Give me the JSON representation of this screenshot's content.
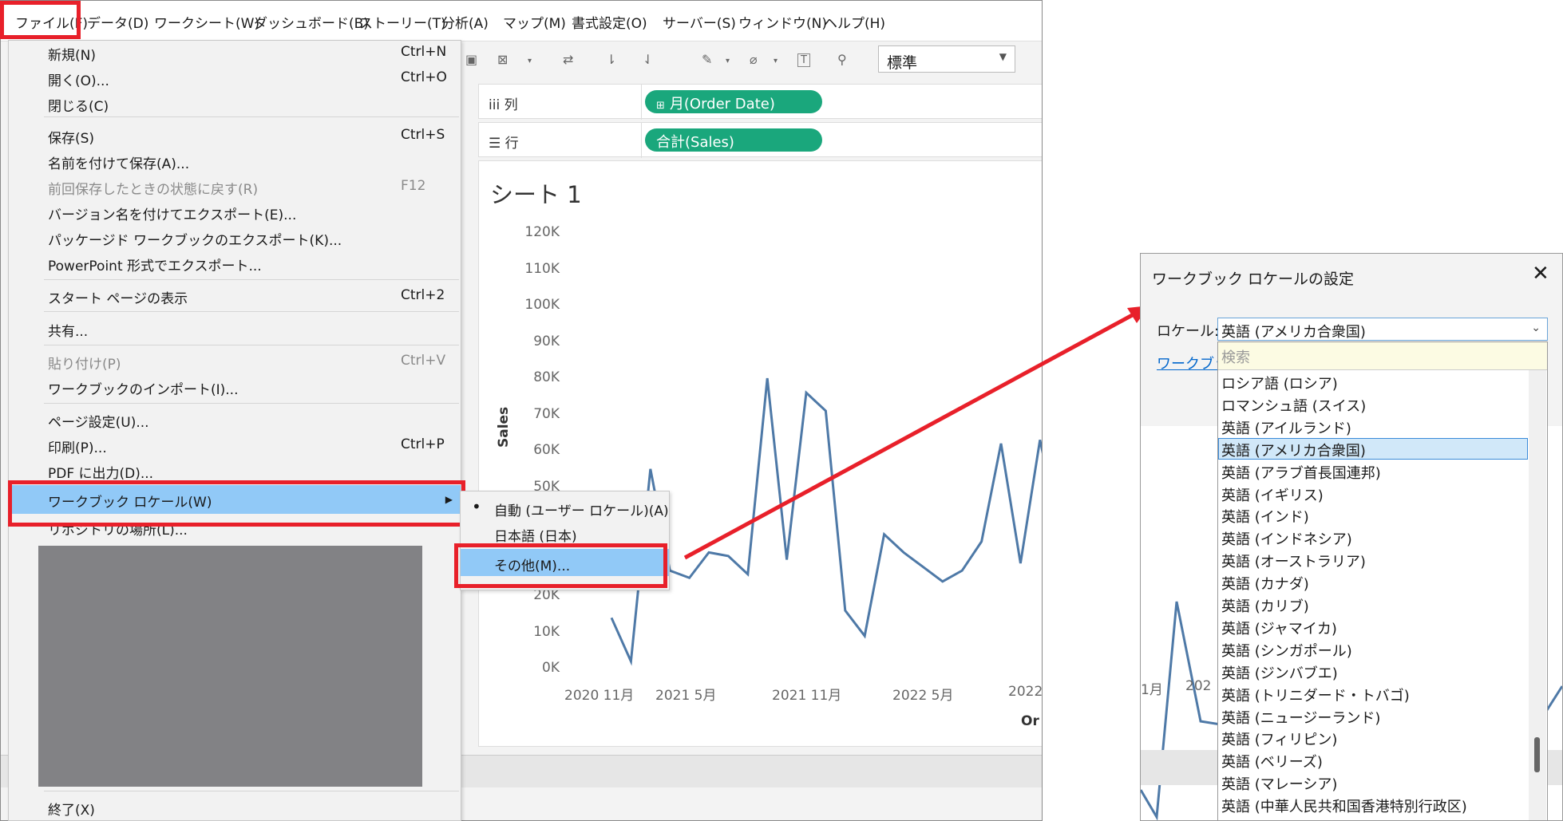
{
  "menubar": {
    "items": [
      "ファイル(F)",
      "データ(D)",
      "ワークシート(W)",
      "ダッシュボード(B)",
      "ストーリー(T)",
      "分析(A)",
      "マップ(M)",
      "書式設定(O)",
      "サーバー(S)",
      "ウィンドウ(N)",
      "ヘルプ(H)"
    ]
  },
  "toolbar": {
    "standard_select": "標準"
  },
  "shelves": {
    "columns_label": "列",
    "columns_pill": "月(Order Date)",
    "rows_label": "行",
    "rows_pill": "合計(Sales)"
  },
  "sheet": {
    "title": "シート 1",
    "x_axis_title_partial": "Or"
  },
  "chart_data": {
    "type": "line",
    "ylabel": "Sales",
    "yticks": [
      "120K",
      "110K",
      "100K",
      "90K",
      "80K",
      "70K",
      "60K",
      "50K",
      "40K",
      "30K",
      "20K",
      "10K",
      "0K"
    ],
    "xticks": [
      "2020 11月",
      "2021 5月",
      "2021 11月",
      "2022 5月",
      "2022"
    ],
    "ylim": [
      0,
      120000
    ],
    "x": [
      "2020-11",
      "2020-12",
      "2021-01",
      "2021-02",
      "2021-03",
      "2021-04",
      "2021-05",
      "2021-06",
      "2021-07",
      "2021-08",
      "2021-09",
      "2021-10",
      "2021-11",
      "2021-12",
      "2022-01",
      "2022-02",
      "2022-03",
      "2022-04",
      "2022-05",
      "2022-06",
      "2022-07",
      "2022-08",
      "2022-09",
      "2022-10",
      "2022-11"
    ],
    "series": [
      {
        "values": [
          14000,
          2000,
          55000,
          27000,
          25000,
          32000,
          31000,
          26000,
          80000,
          30000,
          76000,
          71000,
          16000,
          9000,
          37000,
          32000,
          28000,
          24000,
          27000,
          35000,
          62000,
          29000,
          63000,
          38000,
          37000
        ]
      }
    ]
  },
  "file_menu": {
    "items": [
      {
        "label": "新規(N)",
        "shortcut": "Ctrl+N"
      },
      {
        "label": "開く(O)...",
        "shortcut": "Ctrl+O"
      },
      {
        "label": "閉じる(C)",
        "shortcut": ""
      },
      {
        "label": "保存(S)",
        "shortcut": "Ctrl+S"
      },
      {
        "label": "名前を付けて保存(A)...",
        "shortcut": ""
      },
      {
        "label": "前回保存したときの状態に戻す(R)",
        "shortcut": "F12"
      },
      {
        "label": "バージョン名を付けてエクスポート(E)...",
        "shortcut": ""
      },
      {
        "label": "パッケージド ワークブックのエクスポート(K)...",
        "shortcut": ""
      },
      {
        "label": "PowerPoint 形式でエクスポート...",
        "shortcut": ""
      },
      {
        "label": "スタート ページの表示",
        "shortcut": "Ctrl+2"
      },
      {
        "label": "共有...",
        "shortcut": ""
      },
      {
        "label": "貼り付け(P)",
        "shortcut": "Ctrl+V"
      },
      {
        "label": "ワークブックのインポート(I)...",
        "shortcut": ""
      },
      {
        "label": "ページ設定(U)...",
        "shortcut": ""
      },
      {
        "label": "印刷(P)...",
        "shortcut": "Ctrl+P"
      },
      {
        "label": "PDF に出力(D)...",
        "shortcut": ""
      },
      {
        "label": "ワークブック ロケール(W)",
        "shortcut": ""
      },
      {
        "label": "リポジトリの場所(L)...",
        "shortcut": ""
      },
      {
        "label": "終了(X)",
        "shortcut": ""
      }
    ]
  },
  "submenu": {
    "items": [
      "自動 (ユーザー ロケール)(A)",
      "日本語 (日本)",
      "その他(M)..."
    ]
  },
  "dialog": {
    "title": "ワークブック ロケールの設定",
    "locale_label": "ロケール:",
    "locale_value": "英語 (アメリカ合衆国)",
    "link_partial": "ワークブッ",
    "search_placeholder": "検索",
    "bg_xticks": [
      "1月",
      "202"
    ],
    "options": [
      "ロシア語 (ロシア)",
      "ロマンシュ語 (スイス)",
      "英語 (アイルランド)",
      "英語 (アメリカ合衆国)",
      "英語 (アラブ首長国連邦)",
      "英語 (イギリス)",
      "英語 (インド)",
      "英語 (インドネシア)",
      "英語 (オーストラリア)",
      "英語 (カナダ)",
      "英語 (カリブ)",
      "英語 (ジャマイカ)",
      "英語 (シンガポール)",
      "英語 (ジンバブエ)",
      "英語 (トリニダード・トバゴ)",
      "英語 (ニュージーランド)",
      "英語 (フィリピン)",
      "英語 (ベリーズ)",
      "英語 (マレーシア)",
      "英語 (中華人民共和国香港特別行政区)"
    ]
  },
  "colors": {
    "highlight_red": "#e8202a",
    "menu_hover": "#91c9f7",
    "pill_green": "#1aa77c",
    "line": "#4e79a7"
  }
}
